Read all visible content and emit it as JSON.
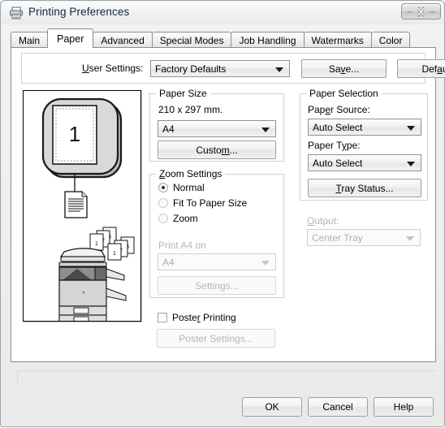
{
  "window": {
    "title": "Printing Preferences",
    "icon": "printer-icon",
    "close_label": "X"
  },
  "tabs": [
    {
      "label": "Main",
      "active": false
    },
    {
      "label": "Paper",
      "active": true
    },
    {
      "label": "Advanced",
      "active": false
    },
    {
      "label": "Special Modes",
      "active": false
    },
    {
      "label": "Job Handling",
      "active": false
    },
    {
      "label": "Watermarks",
      "active": false
    },
    {
      "label": "Color",
      "active": false
    }
  ],
  "settings_bar": {
    "user_settings_label": "User Settings:",
    "user_settings_value": "Factory Defaults",
    "save_label": "Save...",
    "defaults_label": "Defaults"
  },
  "preview": {
    "page_number": "1",
    "stack_numbers": [
      "1",
      "2",
      "3"
    ]
  },
  "paper_size": {
    "group_title": "Paper Size",
    "dimensions": "210 x 297 mm.",
    "value": "A4",
    "custom_label": "Custom..."
  },
  "zoom_settings": {
    "group_title": "Zoom Settings",
    "options": [
      {
        "label": "Normal",
        "selected": true
      },
      {
        "label": "Fit To Paper Size",
        "selected": false
      },
      {
        "label": "Zoom",
        "selected": false
      }
    ],
    "print_on_label": "Print A4 on",
    "print_on_value": "A4",
    "settings_label": "Settings..."
  },
  "poster": {
    "checkbox_label": "Poster Printing",
    "checked": false,
    "settings_label": "Poster Settings..."
  },
  "paper_selection": {
    "group_title": "Paper Selection",
    "source_label": "Paper Source:",
    "source_value": "Auto Select",
    "type_label": "Paper Type:",
    "type_value": "Auto Select",
    "tray_status_label": "Tray Status..."
  },
  "output": {
    "label": "Output:",
    "value": "Center Tray"
  },
  "status_bar": {
    "text": ""
  },
  "buttons": {
    "ok": "OK",
    "cancel": "Cancel",
    "help": "Help"
  }
}
